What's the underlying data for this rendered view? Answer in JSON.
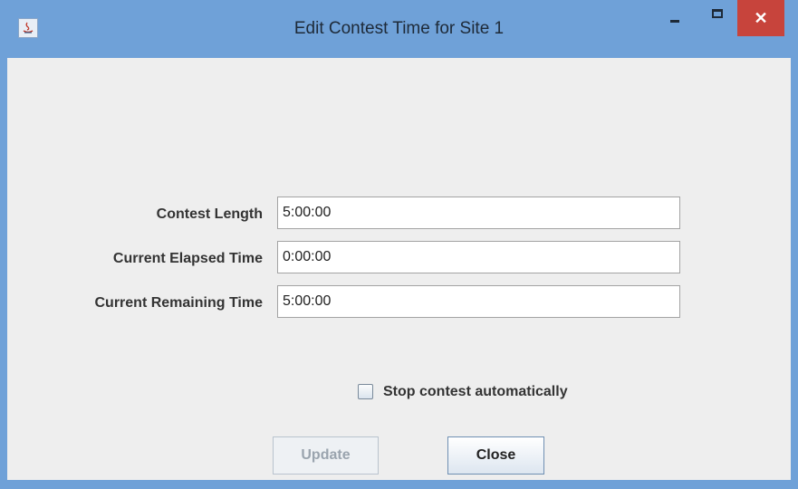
{
  "window": {
    "title": "Edit Contest Time for Site 1",
    "icons": {
      "app": "java-app-icon",
      "minimize": "minimize-icon",
      "maximize": "maximize-icon",
      "close": "close-icon"
    },
    "close_glyph": "✕"
  },
  "form": {
    "contest_length": {
      "label": "Contest Length",
      "value": "5:00:00"
    },
    "elapsed_time": {
      "label": "Current Elapsed Time",
      "value": "0:00:00"
    },
    "remaining_time": {
      "label": "Current Remaining Time",
      "value": "5:00:00"
    },
    "stop_auto": {
      "label": "Stop contest automatically",
      "checked": false
    }
  },
  "buttons": {
    "update": {
      "label": "Update",
      "enabled": false
    },
    "close": {
      "label": "Close",
      "enabled": true
    }
  },
  "colors": {
    "titlebar": "#6fa1d8",
    "close_button": "#c7443c",
    "client_bg": "#eeeeee"
  }
}
